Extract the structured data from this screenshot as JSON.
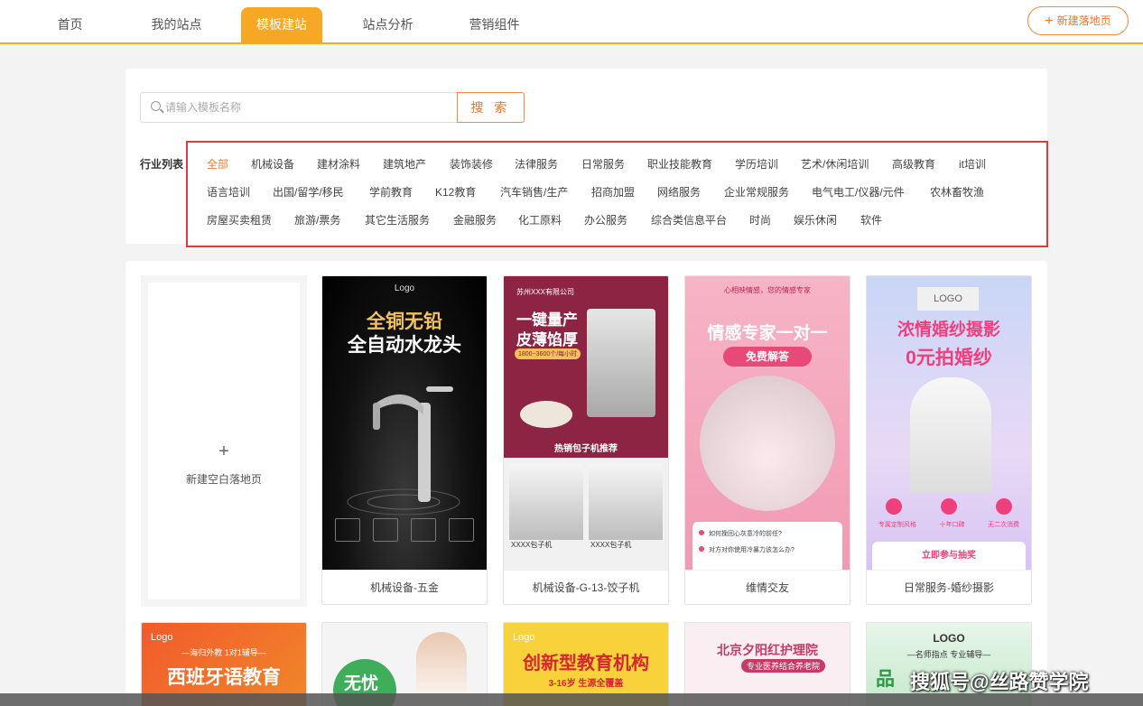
{
  "nav": {
    "tabs": [
      {
        "label": "首页"
      },
      {
        "label": "我的站点"
      },
      {
        "label": "模板建站"
      },
      {
        "label": "站点分析"
      },
      {
        "label": "营销组件"
      }
    ],
    "new_button": "新建落地页"
  },
  "search": {
    "placeholder": "请输入模板名称",
    "button": "搜 索"
  },
  "industry": {
    "label": "行业列表",
    "categories": [
      "全部",
      "机械设备",
      "建材涂料",
      "建筑地产",
      "装饰装修",
      "法律服务",
      "日常服务",
      "职业技能教育",
      "学历培训",
      "艺术/休闲培训",
      "高级教育",
      "it培训",
      "语言培训",
      "出国/留学/移民",
      "学前教育",
      "K12教育",
      "汽车销售/生产",
      "招商加盟",
      "网络服务",
      "企业常规服务",
      "电气电工/仪器/元件",
      "农林畜牧渔",
      "房屋买卖租赁",
      "旅游/票务",
      "其它生活服务",
      "金融服务",
      "化工原料",
      "办公服务",
      "综合类信息平台",
      "时尚",
      "娱乐休闲",
      "软件"
    ]
  },
  "blank_card": {
    "plus": "+",
    "label": "新建空白落地页"
  },
  "templates": [
    {
      "caption": "机械设备-五金",
      "logo": "Logo",
      "title1": "全铜无铅",
      "title2": "全自动水龙头"
    },
    {
      "caption": "机械设备-G-13-饺子机",
      "company": "苏州XXX有限公司",
      "title1": "一键量产",
      "title2": "皮薄馅厚",
      "sub": "1800~3600个/每小时",
      "banner": "热销包子机推荐",
      "item1": "XXXX包子机",
      "item2": "XXXX包子机"
    },
    {
      "caption": "维情交友",
      "tag": "心相映情感，您的情感专家",
      "title1": "情感专家一对一",
      "btn": "免费解答",
      "q1": "如何挽回心灰意冷的前任?",
      "q2": "对方对你使用冷暴力该怎么办?"
    },
    {
      "caption": "日常服务-婚纱摄影",
      "logo": "LOGO",
      "title1": "浓情婚纱摄影",
      "title2": "0元拍婚纱",
      "f1": "专属定制风格",
      "f2": "十年口碑",
      "f3": "无二次消费",
      "cta": "立即参与抽奖"
    }
  ],
  "row2": [
    {
      "logo": "Logo",
      "sub": "—海归外教 1对1辅导—",
      "title": "西班牙语教育"
    },
    {
      "title": "无忧"
    },
    {
      "logo": "Logo",
      "title": "创新型教育机构",
      "sub": "3-16岁 生源全覆盖"
    },
    {
      "title": "北京夕阳红护理院",
      "sub": "专业医养结合养老院"
    },
    {
      "logo": "LOGO",
      "sub": "—名师指点 专业辅导—",
      "title": "品"
    }
  ],
  "watermark": "搜狐号@丝路赞学院",
  "colors": {
    "accent": "#f6a723",
    "orange_text": "#ee7b32",
    "highlight_border": "#e0393e"
  }
}
